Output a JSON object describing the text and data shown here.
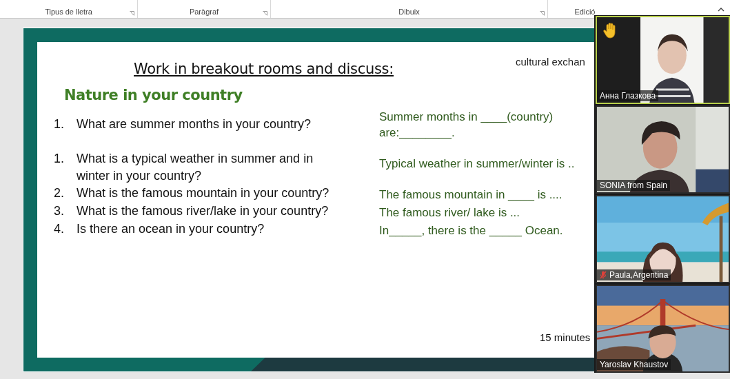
{
  "ribbon": {
    "groups": [
      {
        "label": "Tipus de lletra",
        "launcher": true
      },
      {
        "label": "Paràgraf",
        "launcher": true
      },
      {
        "label": "Dibuix",
        "launcher": true
      },
      {
        "label": "Edició",
        "launcher": false
      }
    ]
  },
  "slide": {
    "corner_text": "cultural exchan",
    "title": "Work in breakout rooms and discuss:",
    "heading": "Nature in your country",
    "rows": [
      {
        "number": "1.",
        "question": "What are summer months in your country?",
        "answer": "Summer months in ____(country) are:________."
      },
      {
        "number": "1.",
        "question": "What is a typical weather in summer and in winter  in your country?",
        "answer": "Typical weather in summer/winter  is .."
      },
      {
        "number": "2.",
        "question": "What is the famous mountain in your country?",
        "answer": "The famous mountain in ____ is ...."
      },
      {
        "number": "3.",
        "question": "What is the famous river/lake in your country?",
        "answer": "The famous river/ lake is ..."
      },
      {
        "number": "4.",
        "question": "Is there an ocean in your country?",
        "answer": "In_____, there is the _____ Ocean."
      }
    ],
    "footer": "15 minutes"
  },
  "video_panel": {
    "tiles": [
      {
        "name": "Анна Глазкова",
        "hand_raised": true,
        "muted": false,
        "active": true
      },
      {
        "name": "SONIA from Spain",
        "hand_raised": false,
        "muted": false,
        "active": false
      },
      {
        "name": "Paula,Argentina",
        "hand_raised": false,
        "muted": true,
        "active": false
      },
      {
        "name": "Yaroslav Khaustov",
        "hand_raised": false,
        "muted": false,
        "active": false
      }
    ]
  }
}
